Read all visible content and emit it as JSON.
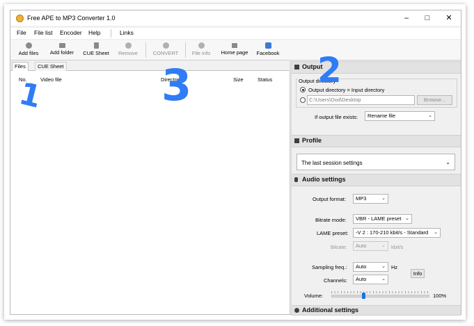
{
  "window": {
    "title": "Free APE to MP3 Converter 1.0",
    "controls": {
      "minimize": "–",
      "maximize": "□",
      "close": "✕"
    }
  },
  "menu": {
    "items": [
      "File",
      "File list",
      "Encoder",
      "Help",
      "Links"
    ]
  },
  "toolbar": {
    "add_files": "Add files",
    "add_folder": "Add folder",
    "cue_sheet": "CUE Sheet",
    "remove": "Remove",
    "convert": "CONVERT",
    "file_info": "File info",
    "home_page": "Home page",
    "facebook": "Facebook"
  },
  "files_panel": {
    "tabs": [
      "Files",
      "CUE Sheet"
    ],
    "columns": [
      "No.",
      "Video file",
      "Director",
      "Size",
      "Status"
    ]
  },
  "output": {
    "header": "Output",
    "group_title": "Output directory",
    "same_dir_label": "Output directory = Input directory",
    "path_value": "C:\\Users\\Dod\\Desktop",
    "browse_label": "Browse...",
    "exists_label": "If output file exists:",
    "exists_value": "Rename file"
  },
  "profile": {
    "header": "Profile",
    "value": "The last session settings"
  },
  "audio": {
    "header": "Audio settings",
    "format_label": "Output format:",
    "format_value": "MP3",
    "bitrate_mode_label": "Bitrate mode:",
    "bitrate_mode_value": "VBR - LAME preset",
    "lame_label": "LAME preset:",
    "lame_value": "-V 2 : 170-210 kbit/s - Standard",
    "bitrate_label": "Bitrate:",
    "bitrate_value": "Auto",
    "bitrate_unit": "kbit/s",
    "sampling_label": "Sampling freq.:",
    "sampling_value": "Auto",
    "sampling_unit": "Hz",
    "channels_label": "Channels:",
    "channels_value": "Auto",
    "info_label": "Info",
    "volume_label": "Volume:",
    "volume_value": "100%",
    "volume_level": 0.33
  },
  "additional": {
    "header": "Additional settings"
  },
  "annotations": [
    "1",
    "2",
    "3"
  ],
  "colors": {
    "annotation": "#2f7cf6",
    "slider_thumb": "#1a73e8"
  }
}
